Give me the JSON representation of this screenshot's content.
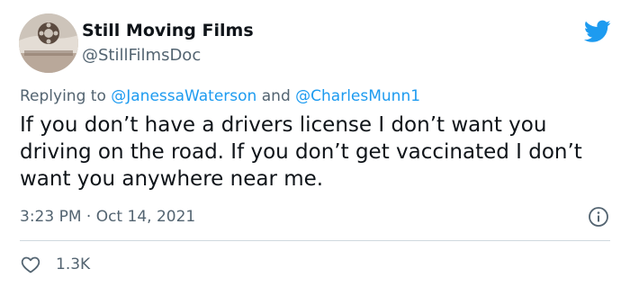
{
  "author": {
    "display_name": "Still Moving Films",
    "handle": "@StillFilmsDoc",
    "avatar_icon": "film-reel-avatar"
  },
  "reply": {
    "prefix": "Replying to ",
    "mention_1": "@JanessaWaterson",
    "conjunction": " and ",
    "mention_2": "@CharlesMunn1"
  },
  "tweet": {
    "text": "If you don’t have a drivers license I don’t want you driving on the road. If you don’t get vaccinated I don’t want you anywhere near me.",
    "timestamp": "3:23 PM · Oct 14, 2021"
  },
  "actions": {
    "like_icon": "heart-icon",
    "like_count": "1.3K",
    "info_icon": "info-icon"
  },
  "brand": {
    "logo_icon": "twitter-bird-icon",
    "accent_color": "#1d9bf0",
    "text_color": "#0f1419",
    "secondary_text_color": "#536471"
  }
}
